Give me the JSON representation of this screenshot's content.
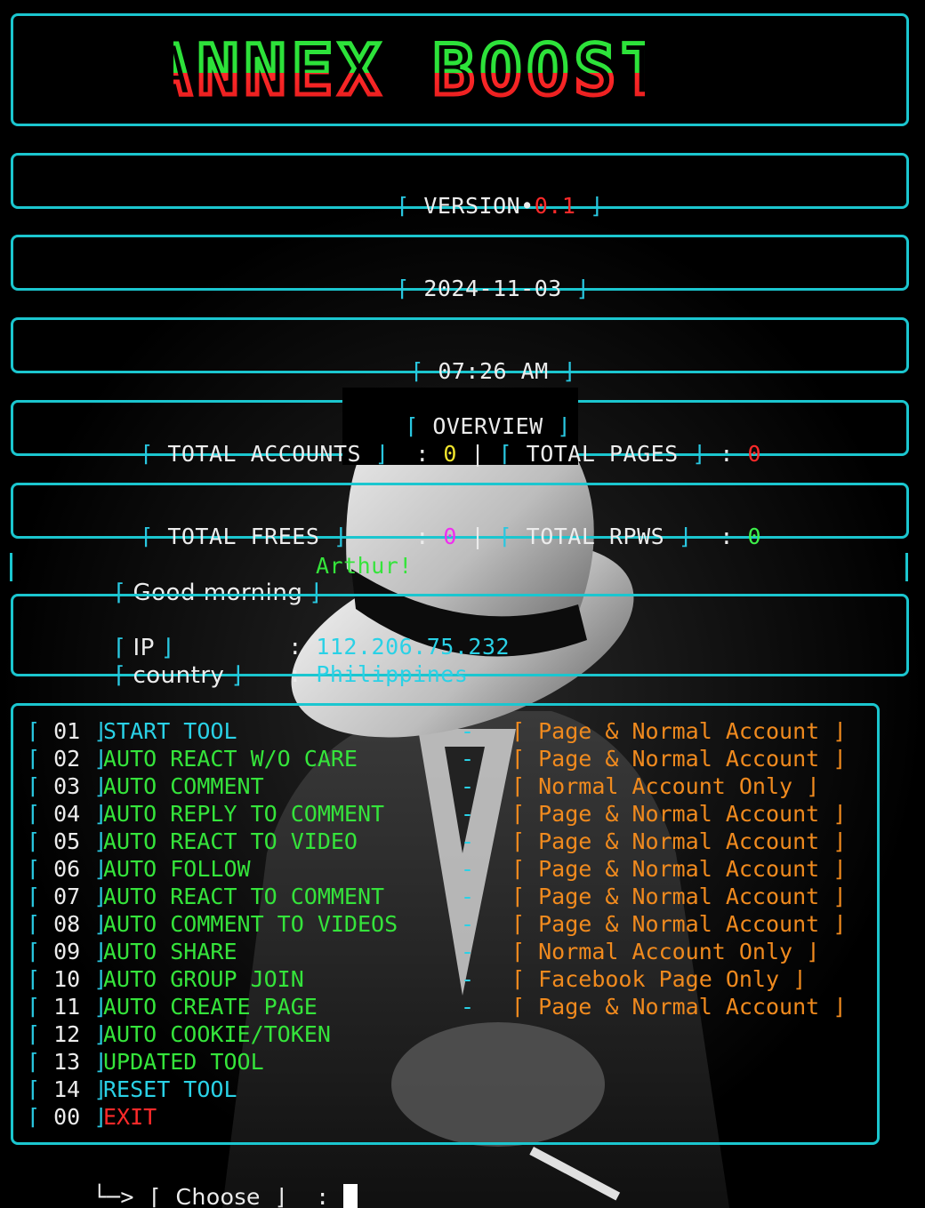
{
  "banner": {
    "text": "ANNEX BOOST"
  },
  "version": {
    "label": "VERSION•",
    "value": "0.1"
  },
  "date": "2024-11-03",
  "time": "07:26 AM",
  "overview": {
    "title": "OVERVIEW",
    "total_accounts_label": "TOTAL ACCOUNTS",
    "total_accounts_value": "0",
    "total_pages_label": "TOTAL PAGES",
    "total_pages_value": "0",
    "total_frees_label": "TOTAL FREES",
    "total_frees_value": "0",
    "total_rpws_label": "TOTAL RPWS",
    "total_rpws_value": "0"
  },
  "greeting": {
    "label": "Good morning",
    "name": "Arthur!"
  },
  "network": {
    "ip_label": "IP",
    "ip_value": "112.206.75.232",
    "country_label": "country",
    "country_value": "Philippines"
  },
  "menu": [
    {
      "num": "01",
      "label": "START TOOL",
      "color": "cyan",
      "account": "Page & Normal Account",
      "show_dash": true
    },
    {
      "num": "02",
      "label": "AUTO REACT W/O CARE",
      "color": "green",
      "account": "Page & Normal Account",
      "show_dash": true
    },
    {
      "num": "03",
      "label": "AUTO COMMENT",
      "color": "green",
      "account": "Normal Account Only",
      "show_dash": true
    },
    {
      "num": "04",
      "label": "AUTO REPLY TO COMMENT",
      "color": "green",
      "account": "Page & Normal Account",
      "show_dash": true
    },
    {
      "num": "05",
      "label": "AUTO REACT TO VIDEO",
      "color": "green",
      "account": "Page & Normal Account",
      "show_dash": true
    },
    {
      "num": "06",
      "label": "AUTO FOLLOW",
      "color": "green",
      "account": "Page & Normal Account",
      "show_dash": true
    },
    {
      "num": "07",
      "label": "AUTO REACT TO COMMENT",
      "color": "green",
      "account": "Page & Normal Account",
      "show_dash": true
    },
    {
      "num": "08",
      "label": "AUTO COMMENT TO VIDEOS",
      "color": "green",
      "account": "Page & Normal Account",
      "show_dash": true
    },
    {
      "num": "09",
      "label": "AUTO SHARE",
      "color": "green",
      "account": "Normal Account Only",
      "show_dash": true
    },
    {
      "num": "10",
      "label": "AUTO GROUP JOIN",
      "color": "green",
      "account": "Facebook Page Only",
      "show_dash": true
    },
    {
      "num": "11",
      "label": "AUTO CREATE PAGE",
      "color": "green",
      "account": "Page & Normal Account",
      "show_dash": true
    },
    {
      "num": "12",
      "label": "AUTO COOKIE/TOKEN",
      "color": "green",
      "account": "",
      "show_dash": false
    },
    {
      "num": "13",
      "label": "UPDATED TOOL",
      "color": "green",
      "account": "",
      "show_dash": false
    },
    {
      "num": "14",
      "label": "RESET TOOL",
      "color": "cyan",
      "account": "",
      "show_dash": false
    },
    {
      "num": "00",
      "label": "EXIT",
      "color": "red",
      "account": "",
      "show_dash": false
    }
  ],
  "prompt": {
    "arrow": "└─>",
    "label": "Choose",
    "separator": ":"
  },
  "colors": {
    "border": "#1bc6cf",
    "cyan": "#2ad1e6",
    "green": "#35e43b",
    "red": "#ff2a2a",
    "yellow": "#f1e52d",
    "magenta": "#f02df0",
    "orange": "#f08a1e"
  }
}
